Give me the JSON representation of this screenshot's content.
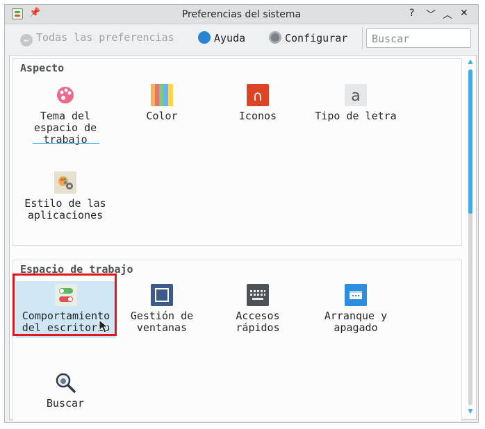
{
  "window": {
    "title": "Preferencias del sistema",
    "buttons": {
      "help": "?",
      "minimize": "﹀",
      "maximize": "︿",
      "close": "✕"
    }
  },
  "toolbar": {
    "back_label": "Todas las preferencias",
    "help_label": "Ayuda",
    "configure_label": "Configurar",
    "search_placeholder": "Buscar"
  },
  "sections": {
    "appearance": {
      "title": "Aspecto",
      "items": [
        {
          "label": "Tema del\nespacio de\ntrabajo",
          "icon": "palette-icon"
        },
        {
          "label": "Color",
          "icon": "color-stripes-icon"
        },
        {
          "label": "Iconos",
          "icon": "icons-icon"
        },
        {
          "label": "Tipo de letra",
          "icon": "font-icon"
        },
        {
          "label": "Estilo de las\naplicaciones",
          "icon": "app-style-icon"
        }
      ]
    },
    "workspace": {
      "title": "Espacio de trabajo",
      "items": [
        {
          "label": "Comportamiento\ndel escritorio",
          "icon": "toggle-switch-icon"
        },
        {
          "label": "Gestión de\nventanas",
          "icon": "window-icon"
        },
        {
          "label": "Accesos\nrápidos",
          "icon": "keyboard-icon"
        },
        {
          "label": "Arranque y\napagado",
          "icon": "startup-icon"
        },
        {
          "label": "Buscar",
          "icon": "magnifier-icon"
        }
      ]
    }
  },
  "colors": {
    "accent": "#3daee9",
    "highlight": "#e0161a",
    "selected_bg": "#cfe6f5"
  }
}
